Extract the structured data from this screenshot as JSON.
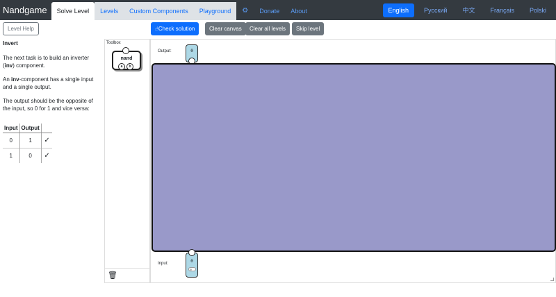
{
  "nav": {
    "brand": "Nandgame",
    "tabs": [
      {
        "label": "Solve Level"
      },
      {
        "label": "Levels"
      },
      {
        "label": "Custom Components"
      },
      {
        "label": "Playground"
      },
      {
        "label": "Donate"
      },
      {
        "label": "About"
      }
    ],
    "settings_icon": "gear-icon",
    "languages": [
      {
        "label": "English"
      },
      {
        "label": "Русский"
      },
      {
        "label": "中文"
      },
      {
        "label": "Français"
      },
      {
        "label": "Polski"
      }
    ]
  },
  "sidebar": {
    "help_button": "Level Help",
    "title": "Invert",
    "p1_a": "The next task is to build an inverter (",
    "p1_b": "inv",
    "p1_c": ") component.",
    "p2_a": "An ",
    "p2_b": "inv",
    "p2_c": "-component has a single input and a single output.",
    "p3": "The output should be the opposite of the input, so 0 for 1 and vice versa:",
    "table": {
      "headers": [
        "Input",
        "Output"
      ],
      "rows": [
        {
          "input": "0",
          "output": "1",
          "status": "✓"
        },
        {
          "input": "1",
          "output": "0",
          "status": "✓"
        }
      ]
    }
  },
  "toolbar": {
    "check": "Check solution",
    "clear_canvas": "Clear canvas",
    "clear_all": "Clear all levels",
    "skip": "Skip level"
  },
  "toolbox": {
    "label": "Toolbox",
    "component": "nand",
    "pins": [
      "a",
      "b"
    ],
    "trash_icon": "trash-icon"
  },
  "canvas": {
    "output_label": "Output:",
    "output_value": "0",
    "input_label": "Input:",
    "input_value": "0"
  },
  "colors": {
    "board": "#9999c9",
    "node": "#add8e6",
    "primary": "#0d6efd",
    "navbar": "#343a40"
  }
}
